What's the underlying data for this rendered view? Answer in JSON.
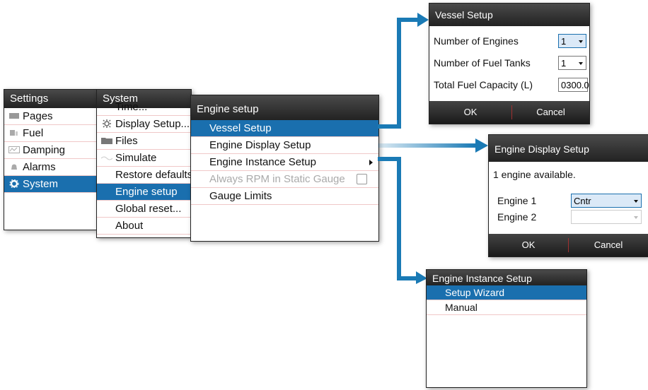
{
  "settings_menu": {
    "title": "Settings",
    "items": [
      {
        "label": "Pages",
        "icon": "pages-icon"
      },
      {
        "label": "Fuel",
        "icon": "fuel-icon"
      },
      {
        "label": "Damping",
        "icon": "damping-icon"
      },
      {
        "label": "Alarms",
        "icon": "alarms-icon"
      },
      {
        "label": "System",
        "icon": "gear-icon",
        "selected": true
      }
    ]
  },
  "system_menu": {
    "title": "System",
    "items": [
      {
        "label": "Time..."
      },
      {
        "label": "Display Setup...",
        "icon": "display-setup-icon"
      },
      {
        "label": "Files",
        "icon": "folder-icon"
      },
      {
        "label": "Simulate",
        "icon": "simulate-icon"
      },
      {
        "label": "Restore defaults..."
      },
      {
        "label": "Engine setup",
        "selected": true
      },
      {
        "label": "Global reset..."
      },
      {
        "label": "About"
      }
    ]
  },
  "engine_setup": {
    "title": "Engine setup",
    "items": [
      {
        "label": "Vessel Setup",
        "selected": true
      },
      {
        "label": "Engine Display Setup"
      },
      {
        "label": "Engine Instance Setup",
        "submenu": true
      },
      {
        "label": "Always RPM in Static Gauge",
        "disabled": true,
        "checkbox": true
      },
      {
        "label": "Gauge Limits"
      }
    ]
  },
  "vessel_setup": {
    "title": "Vessel Setup",
    "rows": [
      {
        "label": "Number of Engines",
        "value": "1"
      },
      {
        "label": "Number of Fuel Tanks",
        "value": "1"
      },
      {
        "label": "Total Fuel Capacity (L)",
        "value": "0300.0"
      }
    ],
    "ok_label": "OK",
    "cancel_label": "Cancel"
  },
  "engine_display_setup": {
    "title": "Engine Display Setup",
    "info": "1 engine available.",
    "rows": [
      {
        "label": "Engine 1",
        "value": "Cntr"
      },
      {
        "label": "Engine 2",
        "value": ""
      }
    ],
    "ok_label": "OK",
    "cancel_label": "Cancel"
  },
  "engine_instance_setup": {
    "title": "Engine Instance Setup",
    "items": [
      {
        "label": "Setup Wizard",
        "selected": true
      },
      {
        "label": "Manual"
      }
    ]
  },
  "colors": {
    "accent": "#1a6fae",
    "titlebar": "#2e2e2e",
    "arrow": "#1a7ab5"
  }
}
